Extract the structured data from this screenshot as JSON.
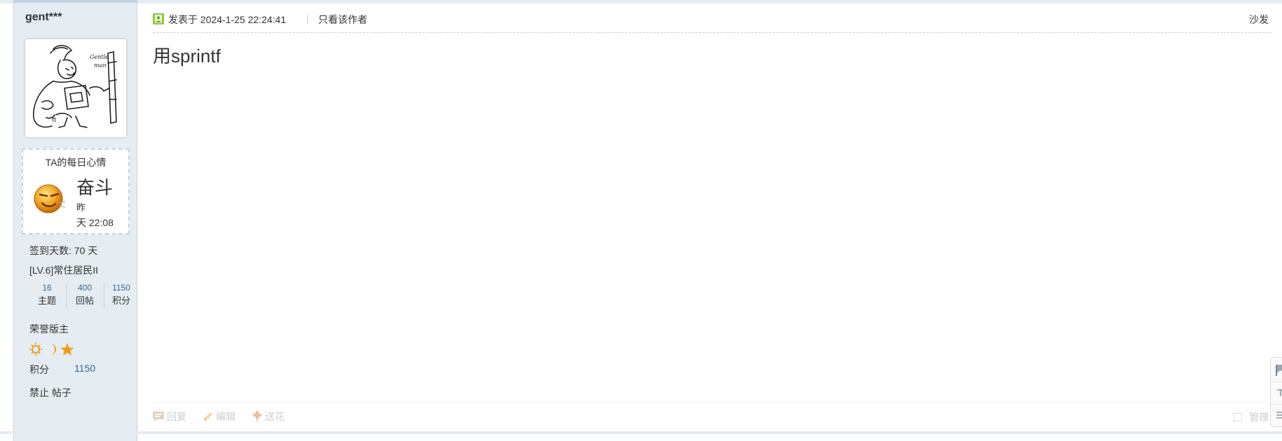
{
  "user": {
    "name": "gent***",
    "mood_title": "TA的每日心情",
    "mood_word": "奋斗",
    "mood_time_line1": "昨",
    "mood_time_line2": "天 22:08",
    "sign_days": "签到天数: 70 天",
    "level": "[LV.6]常住居民II",
    "stats": [
      {
        "num": "16",
        "label": "主题"
      },
      {
        "num": "400",
        "label": "回帖"
      },
      {
        "num": "1150",
        "label": "积分"
      }
    ],
    "honor": "荣誉版主",
    "medals": [
      "sun-icon",
      "moon-icon",
      "star-icon"
    ],
    "points_label": "积分",
    "points_value": "1150",
    "banned": "禁止 帖子"
  },
  "post": {
    "meta": "发表于 2024-1-25 22:24:41",
    "separator": "|",
    "author_only": "只看该作者",
    "floor": "沙发",
    "content": "用sprintf"
  },
  "actions": {
    "reply": "回复",
    "edit": "编辑",
    "flower": "送花",
    "manage": "管理"
  },
  "colors": {
    "sidebar_bg": "#e5edf2",
    "border": "#c2d5e3",
    "link": "#336699",
    "medal_orange": "#f39c12"
  }
}
